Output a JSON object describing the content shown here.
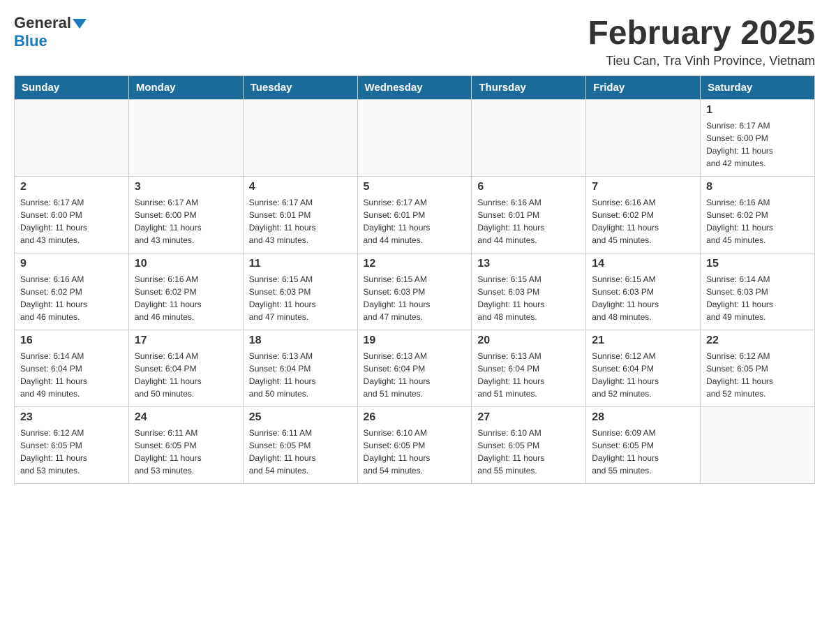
{
  "logo": {
    "general": "General",
    "blue": "Blue"
  },
  "title": "February 2025",
  "subtitle": "Tieu Can, Tra Vinh Province, Vietnam",
  "days_of_week": [
    "Sunday",
    "Monday",
    "Tuesday",
    "Wednesday",
    "Thursday",
    "Friday",
    "Saturday"
  ],
  "weeks": [
    [
      {
        "day": "",
        "info": ""
      },
      {
        "day": "",
        "info": ""
      },
      {
        "day": "",
        "info": ""
      },
      {
        "day": "",
        "info": ""
      },
      {
        "day": "",
        "info": ""
      },
      {
        "day": "",
        "info": ""
      },
      {
        "day": "1",
        "info": "Sunrise: 6:17 AM\nSunset: 6:00 PM\nDaylight: 11 hours\nand 42 minutes."
      }
    ],
    [
      {
        "day": "2",
        "info": "Sunrise: 6:17 AM\nSunset: 6:00 PM\nDaylight: 11 hours\nand 43 minutes."
      },
      {
        "day": "3",
        "info": "Sunrise: 6:17 AM\nSunset: 6:00 PM\nDaylight: 11 hours\nand 43 minutes."
      },
      {
        "day": "4",
        "info": "Sunrise: 6:17 AM\nSunset: 6:01 PM\nDaylight: 11 hours\nand 43 minutes."
      },
      {
        "day": "5",
        "info": "Sunrise: 6:17 AM\nSunset: 6:01 PM\nDaylight: 11 hours\nand 44 minutes."
      },
      {
        "day": "6",
        "info": "Sunrise: 6:16 AM\nSunset: 6:01 PM\nDaylight: 11 hours\nand 44 minutes."
      },
      {
        "day": "7",
        "info": "Sunrise: 6:16 AM\nSunset: 6:02 PM\nDaylight: 11 hours\nand 45 minutes."
      },
      {
        "day": "8",
        "info": "Sunrise: 6:16 AM\nSunset: 6:02 PM\nDaylight: 11 hours\nand 45 minutes."
      }
    ],
    [
      {
        "day": "9",
        "info": "Sunrise: 6:16 AM\nSunset: 6:02 PM\nDaylight: 11 hours\nand 46 minutes."
      },
      {
        "day": "10",
        "info": "Sunrise: 6:16 AM\nSunset: 6:02 PM\nDaylight: 11 hours\nand 46 minutes."
      },
      {
        "day": "11",
        "info": "Sunrise: 6:15 AM\nSunset: 6:03 PM\nDaylight: 11 hours\nand 47 minutes."
      },
      {
        "day": "12",
        "info": "Sunrise: 6:15 AM\nSunset: 6:03 PM\nDaylight: 11 hours\nand 47 minutes."
      },
      {
        "day": "13",
        "info": "Sunrise: 6:15 AM\nSunset: 6:03 PM\nDaylight: 11 hours\nand 48 minutes."
      },
      {
        "day": "14",
        "info": "Sunrise: 6:15 AM\nSunset: 6:03 PM\nDaylight: 11 hours\nand 48 minutes."
      },
      {
        "day": "15",
        "info": "Sunrise: 6:14 AM\nSunset: 6:03 PM\nDaylight: 11 hours\nand 49 minutes."
      }
    ],
    [
      {
        "day": "16",
        "info": "Sunrise: 6:14 AM\nSunset: 6:04 PM\nDaylight: 11 hours\nand 49 minutes."
      },
      {
        "day": "17",
        "info": "Sunrise: 6:14 AM\nSunset: 6:04 PM\nDaylight: 11 hours\nand 50 minutes."
      },
      {
        "day": "18",
        "info": "Sunrise: 6:13 AM\nSunset: 6:04 PM\nDaylight: 11 hours\nand 50 minutes."
      },
      {
        "day": "19",
        "info": "Sunrise: 6:13 AM\nSunset: 6:04 PM\nDaylight: 11 hours\nand 51 minutes."
      },
      {
        "day": "20",
        "info": "Sunrise: 6:13 AM\nSunset: 6:04 PM\nDaylight: 11 hours\nand 51 minutes."
      },
      {
        "day": "21",
        "info": "Sunrise: 6:12 AM\nSunset: 6:04 PM\nDaylight: 11 hours\nand 52 minutes."
      },
      {
        "day": "22",
        "info": "Sunrise: 6:12 AM\nSunset: 6:05 PM\nDaylight: 11 hours\nand 52 minutes."
      }
    ],
    [
      {
        "day": "23",
        "info": "Sunrise: 6:12 AM\nSunset: 6:05 PM\nDaylight: 11 hours\nand 53 minutes."
      },
      {
        "day": "24",
        "info": "Sunrise: 6:11 AM\nSunset: 6:05 PM\nDaylight: 11 hours\nand 53 minutes."
      },
      {
        "day": "25",
        "info": "Sunrise: 6:11 AM\nSunset: 6:05 PM\nDaylight: 11 hours\nand 54 minutes."
      },
      {
        "day": "26",
        "info": "Sunrise: 6:10 AM\nSunset: 6:05 PM\nDaylight: 11 hours\nand 54 minutes."
      },
      {
        "day": "27",
        "info": "Sunrise: 6:10 AM\nSunset: 6:05 PM\nDaylight: 11 hours\nand 55 minutes."
      },
      {
        "day": "28",
        "info": "Sunrise: 6:09 AM\nSunset: 6:05 PM\nDaylight: 11 hours\nand 55 minutes."
      },
      {
        "day": "",
        "info": ""
      }
    ]
  ]
}
